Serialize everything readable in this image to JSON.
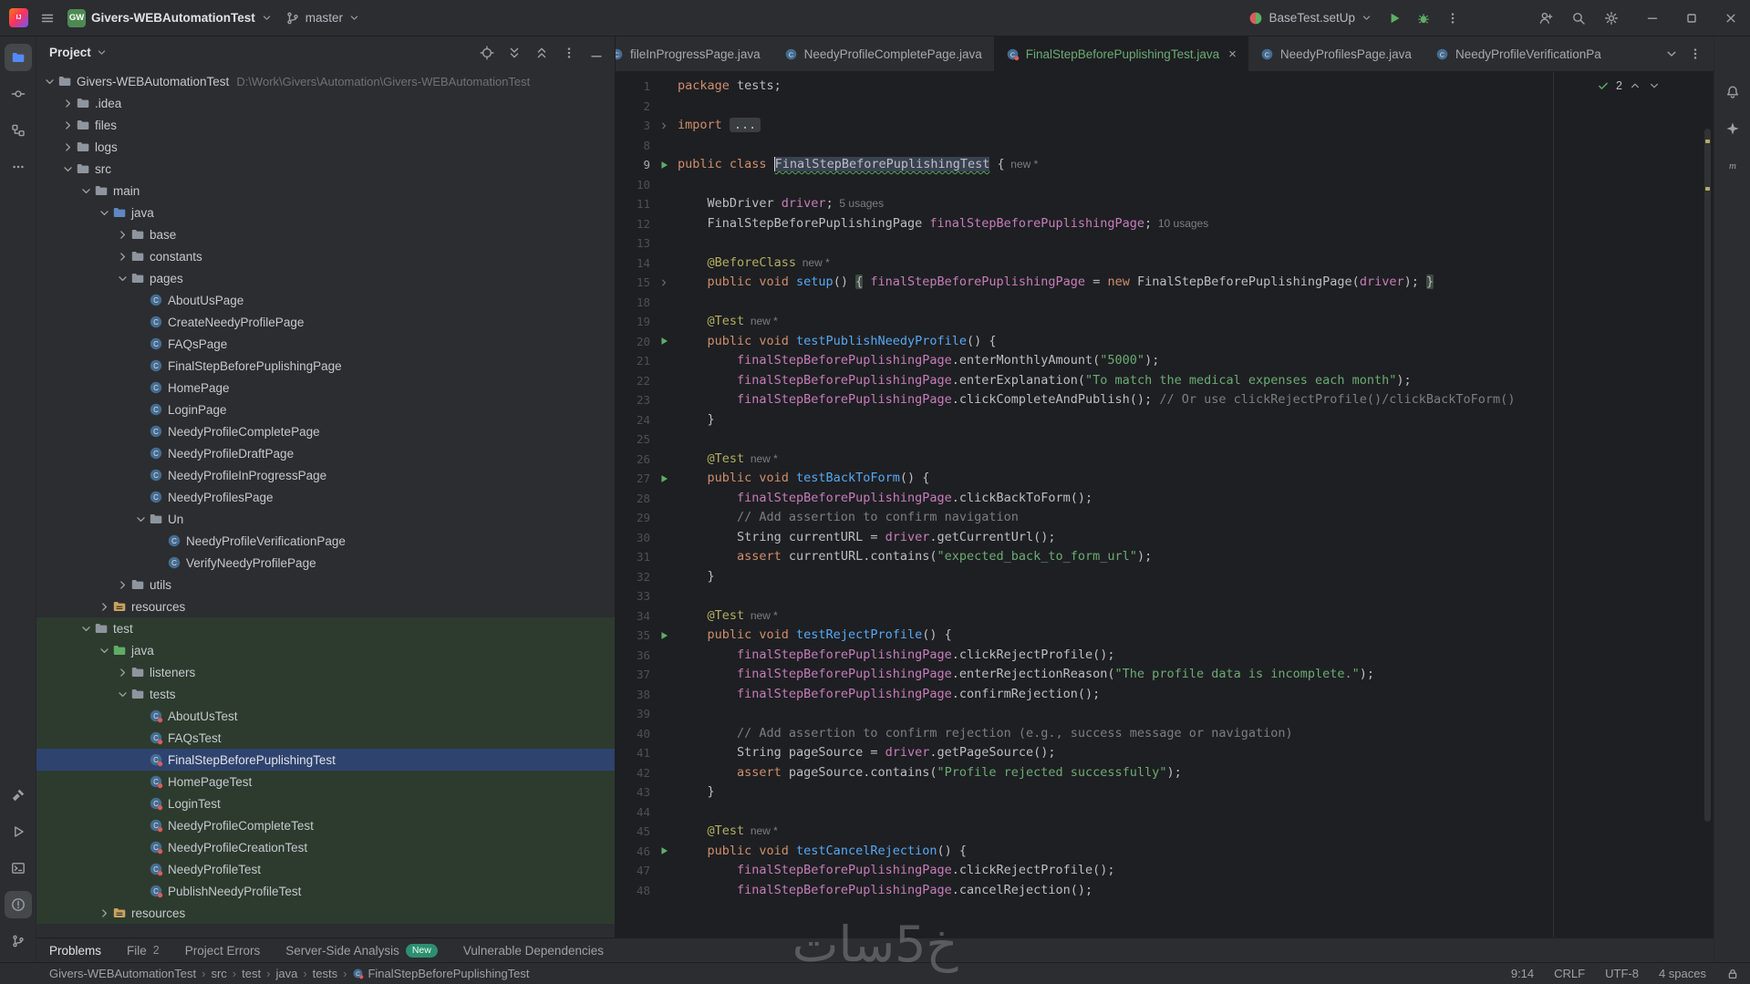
{
  "title_bar": {
    "project_button": {
      "badge": "GW",
      "label": "Givers-WEBAutomationTest"
    },
    "branch_button": {
      "label": "master"
    },
    "run_widget": {
      "config": "BaseTest.setUp"
    }
  },
  "left_toolbar": {
    "top": [
      {
        "name": "project",
        "icon": "folder",
        "active": true,
        "color": "blue"
      },
      {
        "name": "commit",
        "icon": "commit"
      },
      {
        "name": "structure",
        "icon": "structure"
      },
      {
        "name": "more-tools",
        "icon": "ellipsis-h"
      }
    ],
    "bottom": [
      {
        "name": "build",
        "icon": "hammer"
      },
      {
        "name": "run",
        "icon": "run-o"
      },
      {
        "name": "terminal",
        "icon": "terminal"
      },
      {
        "name": "problems",
        "icon": "problems",
        "active": true
      },
      {
        "name": "version-control",
        "icon": "branch"
      }
    ]
  },
  "right_toolbar": {
    "top": [
      {
        "name": "notifications",
        "icon": "bell"
      },
      {
        "name": "ai-assistant",
        "icon": "ai"
      },
      {
        "name": "maven",
        "icon": "maven"
      }
    ]
  },
  "project_panel": {
    "header": {
      "title": "Project"
    },
    "tree": [
      {
        "label": "Givers-WEBAutomationTest",
        "path": "D:\\Work\\Givers\\Automation\\Givers-WEBAutomationTest",
        "level": 0,
        "t": "dir",
        "chev": "open"
      },
      {
        "label": ".idea",
        "level": 1,
        "t": "dir",
        "chev": "closed"
      },
      {
        "label": "files",
        "level": 1,
        "t": "dir",
        "chev": "closed"
      },
      {
        "label": "logs",
        "level": 1,
        "t": "dir",
        "chev": "closed"
      },
      {
        "label": "src",
        "level": 1,
        "t": "dir",
        "chev": "open"
      },
      {
        "label": "main",
        "level": 2,
        "t": "dir",
        "chev": "open"
      },
      {
        "label": "java",
        "level": 3,
        "t": "src",
        "chev": "open"
      },
      {
        "label": "base",
        "level": 4,
        "t": "pkg",
        "chev": "closed"
      },
      {
        "label": "constants",
        "level": 4,
        "t": "pkg",
        "chev": "closed"
      },
      {
        "label": "pages",
        "level": 4,
        "t": "pkg",
        "chev": "open"
      },
      {
        "label": "AboutUsPage",
        "level": 5,
        "t": "cls"
      },
      {
        "label": "CreateNeedyProfilePage",
        "level": 5,
        "t": "cls"
      },
      {
        "label": "FAQsPage",
        "level": 5,
        "t": "cls"
      },
      {
        "label": "FinalStepBeforePuplishingPage",
        "level": 5,
        "t": "cls"
      },
      {
        "label": "HomePage",
        "level": 5,
        "t": "cls"
      },
      {
        "label": "LoginPage",
        "level": 5,
        "t": "cls"
      },
      {
        "label": "NeedyProfileCompletePage",
        "level": 5,
        "t": "cls"
      },
      {
        "label": "NeedyProfileDraftPage",
        "level": 5,
        "t": "cls"
      },
      {
        "label": "NeedyProfileInProgressPage",
        "level": 5,
        "t": "cls"
      },
      {
        "label": "NeedyProfilesPage",
        "level": 5,
        "t": "cls"
      },
      {
        "label": "Un",
        "level": 5,
        "t": "pkg",
        "chev": "open"
      },
      {
        "label": "NeedyProfileVerificationPage",
        "level": 6,
        "t": "cls"
      },
      {
        "label": "VerifyNeedyProfilePage",
        "level": 6,
        "t": "cls"
      },
      {
        "label": "utils",
        "level": 4,
        "t": "pkg",
        "chev": "closed"
      },
      {
        "label": "resources",
        "level": 3,
        "t": "res",
        "chev": "closed"
      },
      {
        "label": "test",
        "level": 2,
        "t": "dir",
        "chev": "open",
        "scope": "test"
      },
      {
        "label": "java",
        "level": 3,
        "t": "testsrc",
        "chev": "open",
        "scope": "test"
      },
      {
        "label": "listeners",
        "level": 4,
        "t": "pkg",
        "chev": "closed",
        "scope": "test"
      },
      {
        "label": "tests",
        "level": 4,
        "t": "pkg",
        "chev": "open",
        "scope": "test"
      },
      {
        "label": "AboutUsTest",
        "level": 5,
        "t": "tcls",
        "scope": "test"
      },
      {
        "label": "FAQsTest",
        "level": 5,
        "t": "tcls",
        "scope": "test"
      },
      {
        "label": "FinalStepBeforePuplishingTest",
        "level": 5,
        "t": "tcls",
        "scope": "test",
        "sel": true
      },
      {
        "label": "HomePageTest",
        "level": 5,
        "t": "tcls",
        "scope": "test"
      },
      {
        "label": "LoginTest",
        "level": 5,
        "t": "tcls",
        "scope": "test"
      },
      {
        "label": "NeedyProfileCompleteTest",
        "level": 5,
        "t": "tcls",
        "scope": "test"
      },
      {
        "label": "NeedyProfileCreationTest",
        "level": 5,
        "t": "tcls",
        "scope": "test"
      },
      {
        "label": "NeedyProfileTest",
        "level": 5,
        "t": "tcls",
        "scope": "test"
      },
      {
        "label": "PublishNeedyProfileTest",
        "level": 5,
        "t": "tcls",
        "scope": "test"
      },
      {
        "label": "resources",
        "level": 3,
        "t": "res",
        "chev": "closed",
        "scope": "test"
      }
    ]
  },
  "editor": {
    "tabs": [
      {
        "label": "fileInProgressPage.java",
        "icon": "class",
        "clip": true
      },
      {
        "label": "NeedyProfileCompletePage.java",
        "icon": "class"
      },
      {
        "label": "FinalStepBeforePuplishingTest.java",
        "icon": "test",
        "active": true,
        "close": true
      },
      {
        "label": "NeedyProfilesPage.java",
        "icon": "class"
      },
      {
        "label": "NeedyProfileVerificationPa",
        "icon": "class"
      }
    ],
    "inspections": {
      "count": "2"
    },
    "lines": [
      {
        "n": 1,
        "g": "",
        "seg": [
          [
            "k",
            "package "
          ],
          [
            "d",
            "tests;"
          ]
        ]
      },
      {
        "n": 2,
        "g": "",
        "seg": []
      },
      {
        "n": 3,
        "g": "fold",
        "seg": [
          [
            "k",
            "import "
          ],
          [
            "fold",
            "..."
          ]
        ]
      },
      {
        "n": 8,
        "g": "",
        "seg": []
      },
      {
        "n": 9,
        "g": "run",
        "cur": true,
        "seg": [
          [
            "k",
            "public class "
          ],
          [
            "hl",
            "FinalStepBeforePuplishingTest"
          ],
          [
            "d",
            " {"
          ],
          [
            "h",
            "  new *"
          ]
        ]
      },
      {
        "n": 10,
        "g": "",
        "seg": []
      },
      {
        "n": 11,
        "g": "",
        "seg": [
          [
            "d",
            "    WebDriver "
          ],
          [
            "f",
            "driver"
          ],
          [
            "d",
            ";"
          ],
          [
            "h",
            "  5 usages"
          ]
        ]
      },
      {
        "n": 12,
        "g": "",
        "seg": [
          [
            "d",
            "    FinalStepBeforePuplishingPage "
          ],
          [
            "f",
            "finalStepBeforePuplishingPage"
          ],
          [
            "d",
            ";"
          ],
          [
            "h",
            "  10 usages"
          ]
        ]
      },
      {
        "n": 13,
        "g": "",
        "seg": []
      },
      {
        "n": 14,
        "g": "",
        "seg": [
          [
            "a",
            "    @BeforeClass"
          ],
          [
            "h",
            "  new *"
          ]
        ]
      },
      {
        "n": 15,
        "g": "fold",
        "seg": [
          [
            "k",
            "    public void "
          ],
          [
            "m",
            "setup"
          ],
          [
            "d",
            "() "
          ],
          [
            "fb",
            "{"
          ],
          [
            "d",
            " "
          ],
          [
            "f",
            "finalStepBeforePuplishingPage"
          ],
          [
            "d",
            " = "
          ],
          [
            "k",
            "new "
          ],
          [
            "d",
            "FinalStepBeforePuplishingPage("
          ],
          [
            "f",
            "driver"
          ],
          [
            "d",
            "); "
          ],
          [
            "fb",
            "}"
          ]
        ]
      },
      {
        "n": 18,
        "g": "",
        "seg": []
      },
      {
        "n": 19,
        "g": "",
        "seg": [
          [
            "a",
            "    @Test"
          ],
          [
            "h",
            "  new *"
          ]
        ]
      },
      {
        "n": 20,
        "g": "run",
        "seg": [
          [
            "k",
            "    public void "
          ],
          [
            "m",
            "testPublishNeedyProfile"
          ],
          [
            "d",
            "() {"
          ]
        ]
      },
      {
        "n": 21,
        "g": "",
        "seg": [
          [
            "d",
            "        "
          ],
          [
            "f",
            "finalStepBeforePuplishingPage"
          ],
          [
            "d",
            ".enterMonthlyAmount("
          ],
          [
            "s",
            "\"5000\""
          ],
          [
            "d",
            ");"
          ]
        ]
      },
      {
        "n": 22,
        "g": "",
        "seg": [
          [
            "d",
            "        "
          ],
          [
            "f",
            "finalStepBeforePuplishingPage"
          ],
          [
            "d",
            ".enterExplanation("
          ],
          [
            "s",
            "\"To match the medical expenses each month\""
          ],
          [
            "d",
            ");"
          ]
        ]
      },
      {
        "n": 23,
        "g": "",
        "seg": [
          [
            "d",
            "        "
          ],
          [
            "f",
            "finalStepBeforePuplishingPage"
          ],
          [
            "d",
            ".clickCompleteAndPublish(); "
          ],
          [
            "c",
            "// Or use clickRejectProfile()/clickBackToForm()"
          ]
        ]
      },
      {
        "n": 24,
        "g": "",
        "seg": [
          [
            "d",
            "    }"
          ]
        ]
      },
      {
        "n": 25,
        "g": "",
        "seg": []
      },
      {
        "n": 26,
        "g": "",
        "seg": [
          [
            "a",
            "    @Test"
          ],
          [
            "h",
            "  new *"
          ]
        ]
      },
      {
        "n": 27,
        "g": "run",
        "seg": [
          [
            "k",
            "    public void "
          ],
          [
            "m",
            "testBackToForm"
          ],
          [
            "d",
            "() {"
          ]
        ]
      },
      {
        "n": 28,
        "g": "",
        "seg": [
          [
            "d",
            "        "
          ],
          [
            "f",
            "finalStepBeforePuplishingPage"
          ],
          [
            "d",
            ".clickBackToForm();"
          ]
        ]
      },
      {
        "n": 29,
        "g": "",
        "seg": [
          [
            "c",
            "        // Add assertion to confirm navigation"
          ]
        ]
      },
      {
        "n": 30,
        "g": "",
        "seg": [
          [
            "d",
            "        String currentURL = "
          ],
          [
            "f",
            "driver"
          ],
          [
            "d",
            ".getCurrentUrl();"
          ]
        ]
      },
      {
        "n": 31,
        "g": "",
        "seg": [
          [
            "k",
            "        assert "
          ],
          [
            "d",
            "currentURL.contains("
          ],
          [
            "s",
            "\"expected_back_to_form_url\""
          ],
          [
            "d",
            ");"
          ]
        ]
      },
      {
        "n": 32,
        "g": "",
        "seg": [
          [
            "d",
            "    }"
          ]
        ]
      },
      {
        "n": 33,
        "g": "",
        "seg": []
      },
      {
        "n": 34,
        "g": "",
        "seg": [
          [
            "a",
            "    @Test"
          ],
          [
            "h",
            "  new *"
          ]
        ]
      },
      {
        "n": 35,
        "g": "run",
        "seg": [
          [
            "k",
            "    public void "
          ],
          [
            "m",
            "testRejectProfile"
          ],
          [
            "d",
            "() {"
          ]
        ]
      },
      {
        "n": 36,
        "g": "",
        "seg": [
          [
            "d",
            "        "
          ],
          [
            "f",
            "finalStepBeforePuplishingPage"
          ],
          [
            "d",
            ".clickRejectProfile();"
          ]
        ]
      },
      {
        "n": 37,
        "g": "",
        "seg": [
          [
            "d",
            "        "
          ],
          [
            "f",
            "finalStepBeforePuplishingPage"
          ],
          [
            "d",
            ".enterRejectionReason("
          ],
          [
            "s",
            "\"The profile data is incomplete.\""
          ],
          [
            "d",
            ");"
          ]
        ]
      },
      {
        "n": 38,
        "g": "",
        "seg": [
          [
            "d",
            "        "
          ],
          [
            "f",
            "finalStepBeforePuplishingPage"
          ],
          [
            "d",
            ".confirmRejection();"
          ]
        ]
      },
      {
        "n": 39,
        "g": "",
        "seg": []
      },
      {
        "n": 40,
        "g": "",
        "seg": [
          [
            "c",
            "        // Add assertion to confirm rejection (e.g., success message or navigation)"
          ]
        ]
      },
      {
        "n": 41,
        "g": "",
        "seg": [
          [
            "d",
            "        String pageSource = "
          ],
          [
            "f",
            "driver"
          ],
          [
            "d",
            ".getPageSource();"
          ]
        ]
      },
      {
        "n": 42,
        "g": "",
        "seg": [
          [
            "k",
            "        assert "
          ],
          [
            "d",
            "pageSource.contains("
          ],
          [
            "s",
            "\"Profile rejected successfully\""
          ],
          [
            "d",
            ");"
          ]
        ]
      },
      {
        "n": 43,
        "g": "",
        "seg": [
          [
            "d",
            "    }"
          ]
        ]
      },
      {
        "n": 44,
        "g": "",
        "seg": []
      },
      {
        "n": 45,
        "g": "",
        "seg": [
          [
            "a",
            "    @Test"
          ],
          [
            "h",
            "  new *"
          ]
        ]
      },
      {
        "n": 46,
        "g": "run",
        "seg": [
          [
            "k",
            "    public void "
          ],
          [
            "m",
            "testCancelRejection"
          ],
          [
            "d",
            "() {"
          ]
        ]
      },
      {
        "n": 47,
        "g": "",
        "seg": [
          [
            "d",
            "        "
          ],
          [
            "f",
            "finalStepBeforePuplishingPage"
          ],
          [
            "d",
            ".clickRejectProfile();"
          ]
        ]
      },
      {
        "n": 48,
        "g": "",
        "seg": [
          [
            "d",
            "        "
          ],
          [
            "f",
            "finalStepBeforePuplishingPage"
          ],
          [
            "d",
            ".cancelRejection();"
          ]
        ]
      }
    ]
  },
  "problems_bar": {
    "items": [
      {
        "label": "Problems"
      },
      {
        "label": "File",
        "count": "2"
      },
      {
        "label": "Project Errors"
      },
      {
        "label": "Server-Side Analysis",
        "badge": "New"
      },
      {
        "label": "Vulnerable Dependencies"
      }
    ]
  },
  "status_bar": {
    "breadcrumbs": [
      "Givers-WEBAutomationTest",
      "src",
      "test",
      "java",
      "tests",
      "FinalStepBeforePuplishingTest"
    ],
    "widgets": [
      {
        "name": "cursor-position",
        "label": "9:14"
      },
      {
        "name": "line-separator",
        "label": "CRLF"
      },
      {
        "name": "file-encoding",
        "label": "UTF-8"
      },
      {
        "name": "indent-style",
        "label": "4 spaces"
      }
    ]
  },
  "watermark": {
    "text": "خ5سات"
  }
}
